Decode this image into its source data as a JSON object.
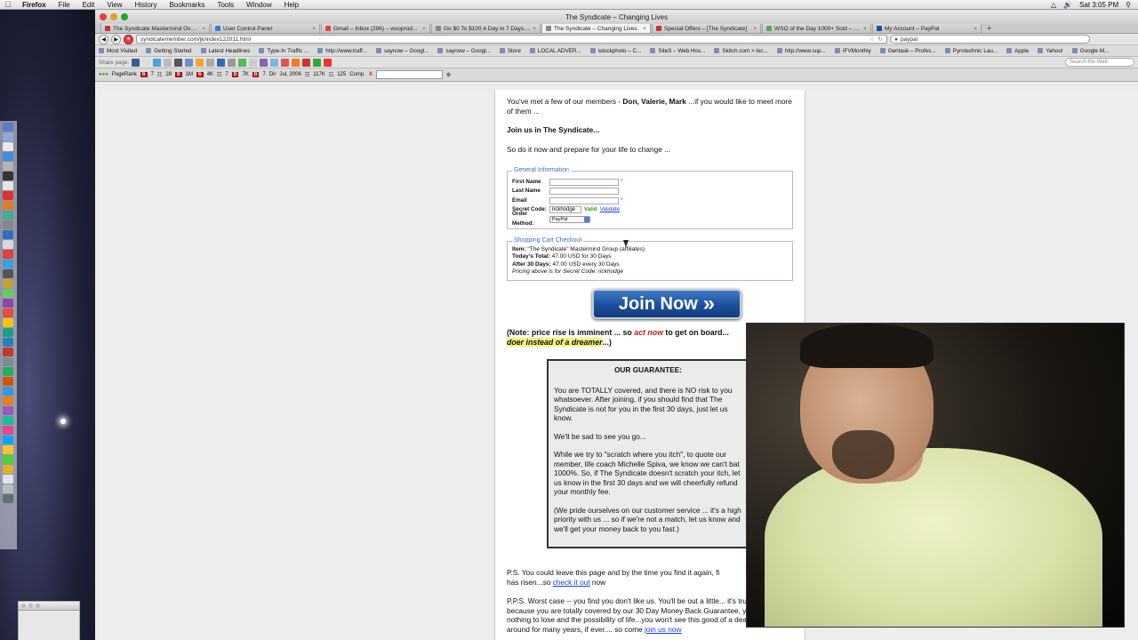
{
  "menubar": {
    "app": "Firefox",
    "items": [
      "File",
      "Edit",
      "View",
      "History",
      "Bookmarks",
      "Tools",
      "Window",
      "Help"
    ],
    "clock": "Sat 3:05 PM"
  },
  "window": {
    "title": "The Syndicate – Changing Lives"
  },
  "tabs": [
    {
      "label": "The Syndicate Mastermind Over...",
      "active": false,
      "color": "#c33"
    },
    {
      "label": "User Control Panel",
      "active": false,
      "color": "#3a7bd5"
    },
    {
      "label": "Gmail – Inbox (296) – wsoprod...",
      "active": false,
      "color": "#d44"
    },
    {
      "label": "Go $0 To $100 A Day in 7 Days!...",
      "active": false,
      "color": "#888"
    },
    {
      "label": "The Syndicate – Changing Lives",
      "active": true,
      "color": "#888"
    },
    {
      "label": "Special Offers – [The Syndicate]",
      "active": false,
      "color": "#c33"
    },
    {
      "label": "WSO of the Day 1000+ Sold – O...",
      "active": false,
      "color": "#5a5"
    },
    {
      "label": "My Account – PayPal",
      "active": false,
      "color": "#1d4f9c"
    }
  ],
  "navbar": {
    "url": "syndicatemember.com/jk/index122011.html",
    "search": "paypal"
  },
  "bookmarks": [
    "Most Visited",
    "Getting Started",
    "Latest Headlines",
    "Type-In Traffic ...",
    "http://www.traff...",
    "saynow – Googl...",
    "saynow – Googl...",
    "Store",
    "LOCAL ADVER...",
    "istockphoto – C...",
    "SiteS – Web Hos...",
    "Skitch.com > loc...",
    "http://www.sup...",
    "IFVMonthly",
    "Gentask – Profes...",
    "Pyrotechnic Lau...",
    "Apple",
    "Yahoo!",
    "Google M..."
  ],
  "sharebar": {
    "label": "Share page:",
    "search_placeholder": "Search the Web"
  },
  "seobar": {
    "pagerank": "PageRank",
    "b1": "7",
    "v1": "28",
    "v2": "1M",
    "v3": "4K",
    "v4": "7",
    "v5": "7K",
    "v6": "7",
    "dir": "Dir",
    "date": "Jul, 2006",
    "v7": "117K",
    "v8": "125",
    "comp": "Comp."
  },
  "content": {
    "intro_pre": "You've met a few of our members - ",
    "intro_names": "Don, Valerie, Mark",
    "intro_post": " ...if you would like to meet more of them ...",
    "join_heading": "Join us in The Syndicate...",
    "change_text": "So do it now and prepare for your life to change ..."
  },
  "form": {
    "legend": "General Information",
    "first_name_label": "First Name",
    "last_name_label": "Last Name",
    "email_label": "Email",
    "secret_label": "Secret Code:",
    "secret_value": "rickhodge",
    "valid_text": "Valid",
    "validate_link": "Validate",
    "order_label": "Order Method:",
    "order_value": "PayPal"
  },
  "cart": {
    "legend": "Shopping Cart Checkout",
    "item_label": "Item:",
    "item_value": " \"The Syndicate\" Mastermind Group (affiliates)",
    "today_label": "Today's Total:",
    "today_value": " 47.00 USD for 30 Days",
    "after_label": "After 30 Days:",
    "after_value": " 47.00 USD every 30 Days",
    "pricing_note": "Pricing above is for Secret Code: rickhodge"
  },
  "join_button": {
    "label": "Join Now",
    "arrows": "»"
  },
  "note": {
    "pre": "(Note:  price rise is imminent ... so ",
    "act": "act now",
    "mid": " to get on board...",
    "hl": "doer instead of a dreamer",
    "post": "...)"
  },
  "guarantee": {
    "title": "OUR GUARANTEE:",
    "p1": "You are TOTALLY covered, and there is NO risk to you whatsoever.  After joining, if you should find that The Syndicate is not for you in the first 30 days, just let us know.",
    "p2": "We'll be sad to see you go...",
    "p3": "While we try to \"scratch where you itch\", to quote our member, life coach Michelle Spiva, we know we can't bat 1000%.  So, if The Syndicate doesn't scratch your itch, let us know in the first 30 days and we will cheerfully refund your monthly fee.",
    "p4": "(We pride ourselves on our customer service ... it's a high priority with us ... so if we're not a match, let us know and we'll get your money back to you fast.)"
  },
  "ps": {
    "ps_pre": "P.S. You could leave this page and by the time you find it again, fi",
    "ps_mid": "has risen...so ",
    "ps_link": "check it out",
    "ps_post": " now",
    "pps": "P.P.S. Worst case -- you find you don't like us.  You'll be out a little... it's true. But because you are totally covered by our 30 Day Money Back Guarantee, you have nothing to lose and the possibility of life...you won't see this good of a deal come around for many years, if ever.... so come ",
    "pps_link": "join us now"
  }
}
